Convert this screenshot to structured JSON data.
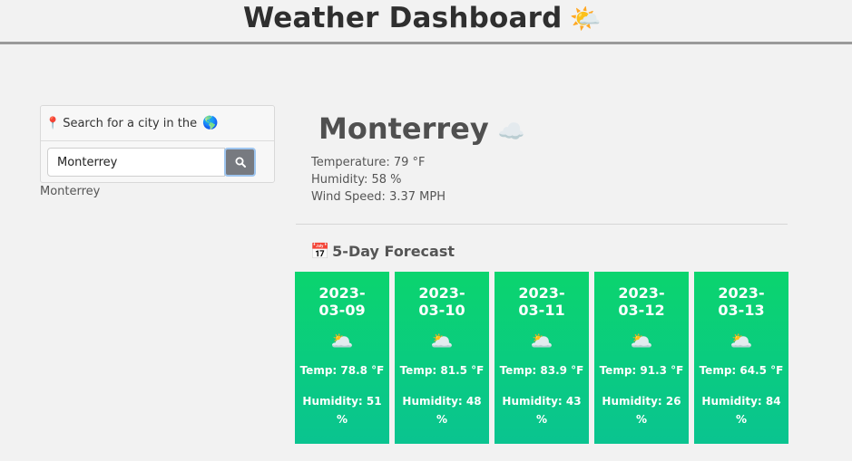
{
  "header": {
    "title": "Weather Dashboard",
    "icon": "sun-behind-cloud-icon",
    "icon_glyph": "🌤️"
  },
  "search": {
    "heading": "Search for a city in the",
    "pin_icon": "📍",
    "globe_icon": "🌎",
    "input_value": "Monterrey",
    "button_icon": "search-icon",
    "history": [
      "Monterrey"
    ]
  },
  "current": {
    "city": "Monterrey",
    "icon_glyph": "☁️",
    "temperature": "Temperature: 79 °F",
    "humidity": "Humidity: 58 %",
    "wind": "Wind Speed: 3.37 MPH"
  },
  "forecast": {
    "title": "5-Day Forecast",
    "calendar_icon": "📅",
    "days": [
      {
        "date_year": "2023-",
        "date_md": "03-09",
        "icon_glyph": "🌥️",
        "temp": "Temp: 78.8 °F",
        "humidity": "Humidity: 51 %"
      },
      {
        "date_year": "2023-",
        "date_md": "03-10",
        "icon_glyph": "🌥️",
        "temp": "Temp: 81.5 °F",
        "humidity": "Humidity: 48 %"
      },
      {
        "date_year": "2023-",
        "date_md": "03-11",
        "icon_glyph": "🌥️",
        "temp": "Temp: 83.9 °F",
        "humidity": "Humidity: 43 %"
      },
      {
        "date_year": "2023-",
        "date_md": "03-12",
        "icon_glyph": "🌥️",
        "temp": "Temp: 91.3 °F",
        "humidity": "Humidity: 26 %"
      },
      {
        "date_year": "2023-",
        "date_md": "03-13",
        "icon_glyph": "🌥️",
        "temp": "Temp: 64.5 °F",
        "humidity": "Humidity: 84 %"
      }
    ]
  },
  "colors": {
    "card_top": "#0bd46e",
    "card_bottom": "#0ac490",
    "button": "#777a80"
  }
}
